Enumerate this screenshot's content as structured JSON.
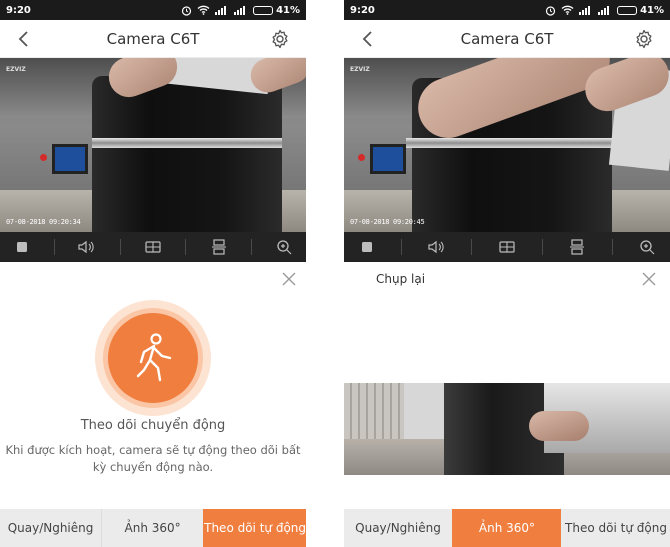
{
  "colors": {
    "accent": "#f07e3f",
    "status_bar": "#1b1b1b",
    "control_bar": "#232323",
    "tab_inactive": "#ebebeb"
  },
  "left_screen": {
    "status_bar": {
      "time": "9:20",
      "battery": "41%",
      "battery_level": 0.41
    },
    "nav": {
      "title": "Camera C6T",
      "back_icon": "chevron-left-icon",
      "settings_icon": "gear-icon"
    },
    "video": {
      "logo": "EZVIZ",
      "timestamp": "07-08-2018 09:20:34"
    },
    "controls": [
      "stop-icon",
      "speaker-icon",
      "split-view-icon",
      "ptz-icon",
      "zoom-in-icon"
    ],
    "panel": {
      "close_icon": "close-icon",
      "feature_icon": "walking-person-icon",
      "title": "Theo dõi chuyển động",
      "description": "Khi được kích hoạt, camera sẽ tự động theo dõi bất kỳ chuyển động nào."
    },
    "tabs": [
      {
        "label": "Quay/Nghiêng",
        "active": false
      },
      {
        "label": "Ảnh 360°",
        "active": false
      },
      {
        "label": "Theo dõi tự động",
        "active": true
      }
    ]
  },
  "right_screen": {
    "status_bar": {
      "time": "9:20",
      "battery": "41%",
      "battery_level": 0.41
    },
    "nav": {
      "title": "Camera C6T",
      "back_icon": "chevron-left-icon",
      "settings_icon": "gear-icon"
    },
    "video": {
      "logo": "EZVIZ",
      "timestamp": "07-08-2018 09:20:45"
    },
    "controls": [
      "stop-icon",
      "speaker-icon",
      "split-view-icon",
      "ptz-icon",
      "zoom-in-icon"
    ],
    "panel": {
      "close_icon": "close-icon",
      "capture_label": "Chụp lại"
    },
    "tabs": [
      {
        "label": "Quay/Nghiêng",
        "active": false
      },
      {
        "label": "Ảnh 360°",
        "active": true
      },
      {
        "label": "Theo dõi tự động",
        "active": false
      }
    ]
  }
}
